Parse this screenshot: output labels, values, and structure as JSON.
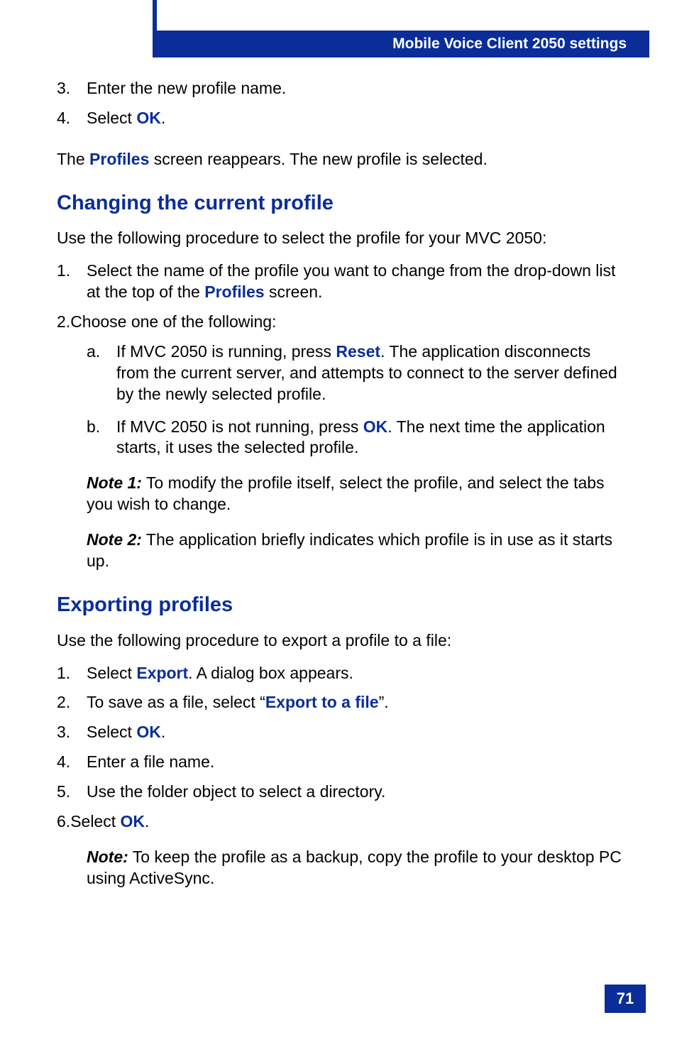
{
  "header": {
    "title": "Mobile Voice Client 2050 settings"
  },
  "top_list": {
    "item3": {
      "num": "3.",
      "text": "Enter the new profile name."
    },
    "item4": {
      "num": "4.",
      "before": "Select ",
      "link": "OK",
      "after": "."
    }
  },
  "para1": {
    "before": "The ",
    "link": "Profiles",
    "after": " screen reappears. The new profile is selected."
  },
  "section1": {
    "heading": "Changing the current profile",
    "intro": "Use the following procedure to select the profile for your MVC 2050:",
    "item1": {
      "num": "1.",
      "before": "Select the name of the profile you want to change from the drop-down list at the top of the ",
      "link": "Profiles",
      "after": " screen."
    },
    "item2": {
      "num": "2.",
      "text": "Choose one of the following:",
      "sub_a": {
        "num": "a.",
        "before": "If MVC 2050 is running, press ",
        "link": "Reset",
        "after": ". The application disconnects from the current server, and attempts to connect to the server defined by the newly selected profile."
      },
      "sub_b": {
        "num": "b.",
        "before": "If MVC 2050 is not running, press ",
        "link": "OK",
        "after": ". The next time the application starts, it uses the selected profile."
      }
    },
    "note1": {
      "label": "Note 1:",
      "text": " To modify the profile itself, select the profile, and select the tabs you wish to change."
    },
    "note2": {
      "label": "Note 2:",
      "text": " The application briefly indicates which profile is in use as it starts up."
    }
  },
  "section2": {
    "heading": "Exporting profiles",
    "intro": "Use the following procedure to export a profile to a file:",
    "item1": {
      "num": "1.",
      "before": "Select ",
      "link": "Export",
      "after": ". A dialog box appears."
    },
    "item2": {
      "num": "2.",
      "before": "To save as a file, select “",
      "link": "Export to a file",
      "after": "”."
    },
    "item3": {
      "num": "3.",
      "before": "Select ",
      "link": "OK",
      "after": "."
    },
    "item4": {
      "num": "4.",
      "text": "Enter a file name."
    },
    "item5": {
      "num": "5.",
      "text": "Use the folder object to select a directory."
    },
    "item6": {
      "num": "6.",
      "before": "Select ",
      "link": "OK",
      "after": "."
    },
    "note": {
      "label": "Note:",
      "text": " To keep the profile as a backup, copy the profile to your desktop PC using ActiveSync."
    }
  },
  "page_number": "71"
}
